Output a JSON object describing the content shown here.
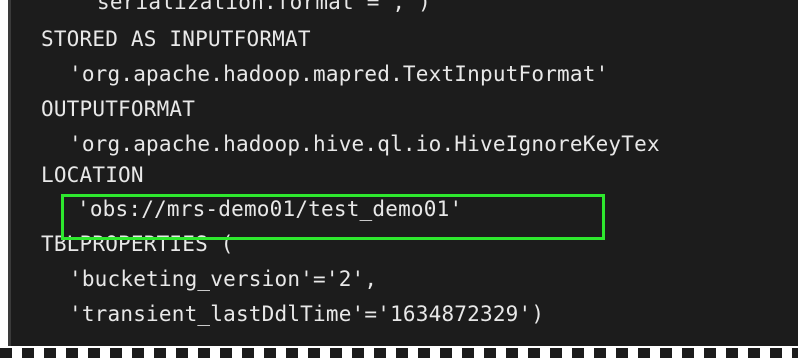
{
  "editor": {
    "lines": [
      "serialization.format = , )",
      "STORED AS INPUTFORMAT",
      "'org.apache.hadoop.mapred.TextInputFormat'",
      "OUTPUTFORMAT",
      "'org.apache.hadoop.hive.ql.io.HiveIgnoreKeyTex",
      "LOCATION",
      "'obs://mrs-demo01/test_demo01'",
      "TBLPROPERTIES (",
      "'bucketing_version'='2',",
      "'transient_lastDdlTime'='1634872329')"
    ],
    "highlight_color": "#2ee82e",
    "background_color": "#1c1c1c",
    "text_color": "#e8e8e8"
  }
}
